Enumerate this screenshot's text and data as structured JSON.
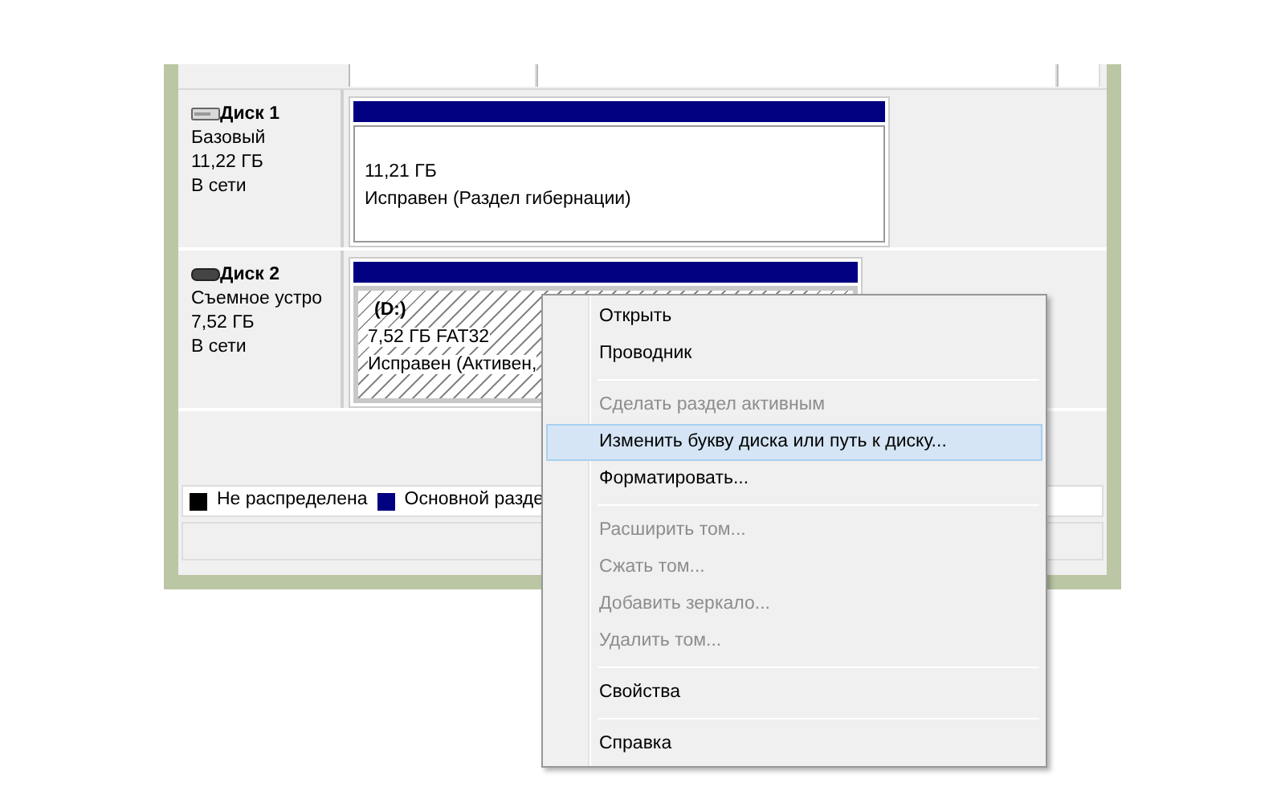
{
  "disks": [
    {
      "name": "Диск 1",
      "kind": "basic",
      "lines": [
        "Базовый",
        "11,22 ГБ",
        "В сети"
      ],
      "partition": {
        "lines": [
          "11,21 ГБ",
          "Исправен (Раздел гибернации)"
        ],
        "selected": false
      }
    },
    {
      "name": "Диск 2",
      "kind": "removable",
      "lines": [
        "Съемное устро",
        "7,52 ГБ",
        "В сети"
      ],
      "partition": {
        "label": "(D:)",
        "lines": [
          "7,52 ГБ FAT32",
          "Исправен (Активен,"
        ],
        "selected": true
      }
    }
  ],
  "legend": [
    {
      "label": "Не распределена",
      "color": "#000000"
    },
    {
      "label": "Основной разде",
      "color": "#000080"
    }
  ],
  "context_menu": [
    {
      "kind": "item",
      "label": "Открыть",
      "disabled": false,
      "selected": false
    },
    {
      "kind": "item",
      "label": "Проводник",
      "disabled": false,
      "selected": false
    },
    {
      "kind": "separator"
    },
    {
      "kind": "item",
      "label": "Сделать раздел активным",
      "disabled": true,
      "selected": false
    },
    {
      "kind": "item",
      "label": "Изменить букву диска или путь к диску...",
      "disabled": false,
      "selected": true
    },
    {
      "kind": "item",
      "label": "Форматировать...",
      "disabled": false,
      "selected": false
    },
    {
      "kind": "separator"
    },
    {
      "kind": "item",
      "label": "Расширить том...",
      "disabled": true,
      "selected": false
    },
    {
      "kind": "item",
      "label": "Сжать том...",
      "disabled": true,
      "selected": false
    },
    {
      "kind": "item",
      "label": "Добавить зеркало...",
      "disabled": true,
      "selected": false
    },
    {
      "kind": "item",
      "label": "Удалить том...",
      "disabled": true,
      "selected": false
    },
    {
      "kind": "separator"
    },
    {
      "kind": "item",
      "label": "Свойства",
      "disabled": false,
      "selected": false
    },
    {
      "kind": "separator"
    },
    {
      "kind": "item",
      "label": "Справка",
      "disabled": false,
      "selected": false
    }
  ]
}
